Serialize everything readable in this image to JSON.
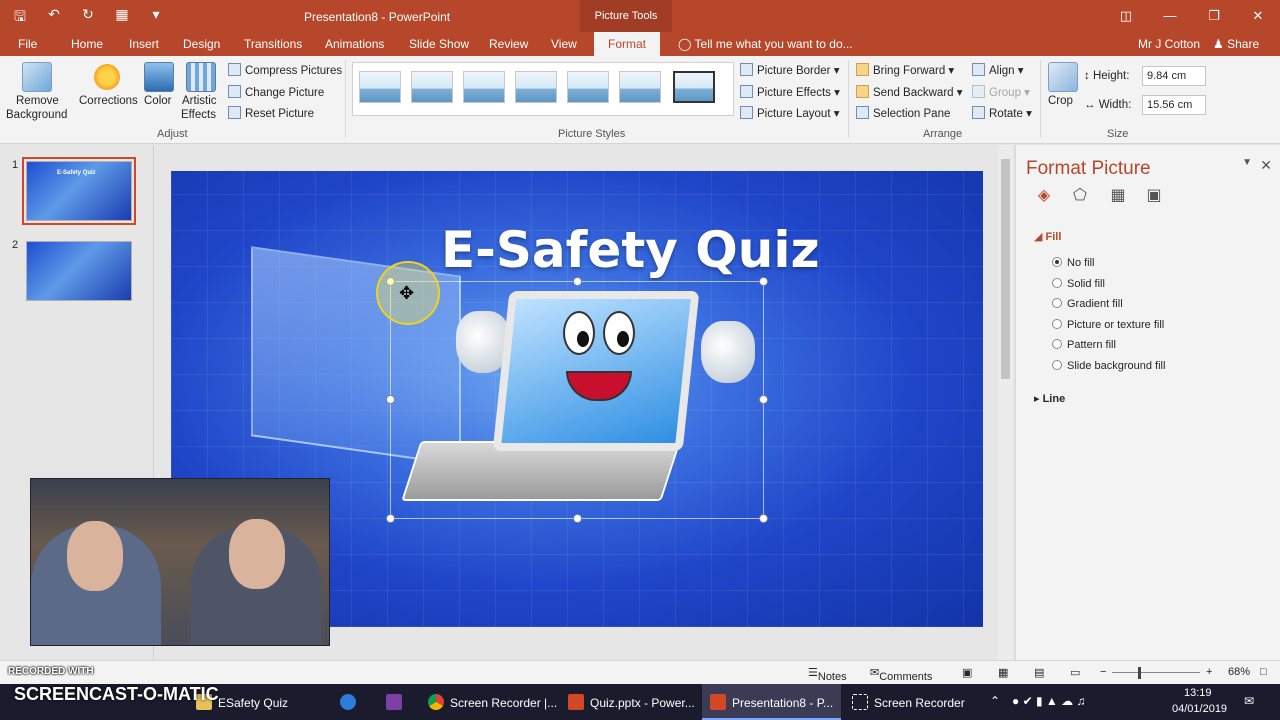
{
  "window": {
    "title": "Presentation8 - PowerPoint",
    "context_tab": "Picture Tools",
    "qat": [
      "save-icon",
      "undo-icon",
      "redo-icon",
      "presenter-icon",
      "customize-icon"
    ]
  },
  "tabs": {
    "items": [
      "File",
      "Home",
      "Insert",
      "Design",
      "Transitions",
      "Animations",
      "Slide Show",
      "Review",
      "View",
      "Format"
    ],
    "active": "Format",
    "tell_me": "Tell me what you want to do...",
    "user": "Mr J Cotton",
    "share": "Share"
  },
  "ribbon": {
    "remove_background_line1": "Remove",
    "remove_background_line2": "Background",
    "corrections": "Corrections",
    "color": "Color",
    "artistic_line1": "Artistic",
    "artistic_line2": "Effects",
    "compress": "Compress Pictures",
    "change": "Change Picture",
    "reset": "Reset Picture",
    "adjust_label": "Adjust",
    "picture_styles_label": "Picture Styles",
    "picture_border": "Picture Border",
    "picture_effects": "Picture Effects",
    "picture_layout": "Picture Layout",
    "bring_forward": "Bring Forward",
    "send_backward": "Send Backward",
    "selection_pane": "Selection Pane",
    "align": "Align",
    "group": "Group",
    "rotate": "Rotate",
    "arrange_label": "Arrange",
    "crop": "Crop",
    "height_label": "Height:",
    "height_value": "9.84 cm",
    "width_label": "Width:",
    "width_value": "15.56 cm",
    "size_label": "Size"
  },
  "thumbnails": [
    {
      "num": "1",
      "label": "E-Safety Quiz"
    },
    {
      "num": "2",
      "label": ""
    }
  ],
  "slide": {
    "title": "E-Safety Quiz"
  },
  "pane": {
    "title": "Format Picture",
    "fill_header": "Fill",
    "options": [
      "No fill",
      "Solid fill",
      "Gradient fill",
      "Picture or texture fill",
      "Pattern fill",
      "Slide background fill"
    ],
    "selected": "No fill",
    "line_header": "Line"
  },
  "status": {
    "notes": "Notes",
    "comments": "Comments",
    "zoom": "68%"
  },
  "taskbar": {
    "items": [
      "ESafety Quiz",
      "Screen Recorder |...",
      "Quiz.pptx - Power...",
      "Presentation8 - P...",
      "Screen Recorder"
    ],
    "time": "13:19",
    "date": "04/01/2019"
  },
  "overlay": {
    "recorded": "RECORDED WITH",
    "brand": "SCREENCAST-O-MATIC"
  },
  "colors": {
    "accent": "#b7472a",
    "slide_bg": "#1f45c8"
  }
}
